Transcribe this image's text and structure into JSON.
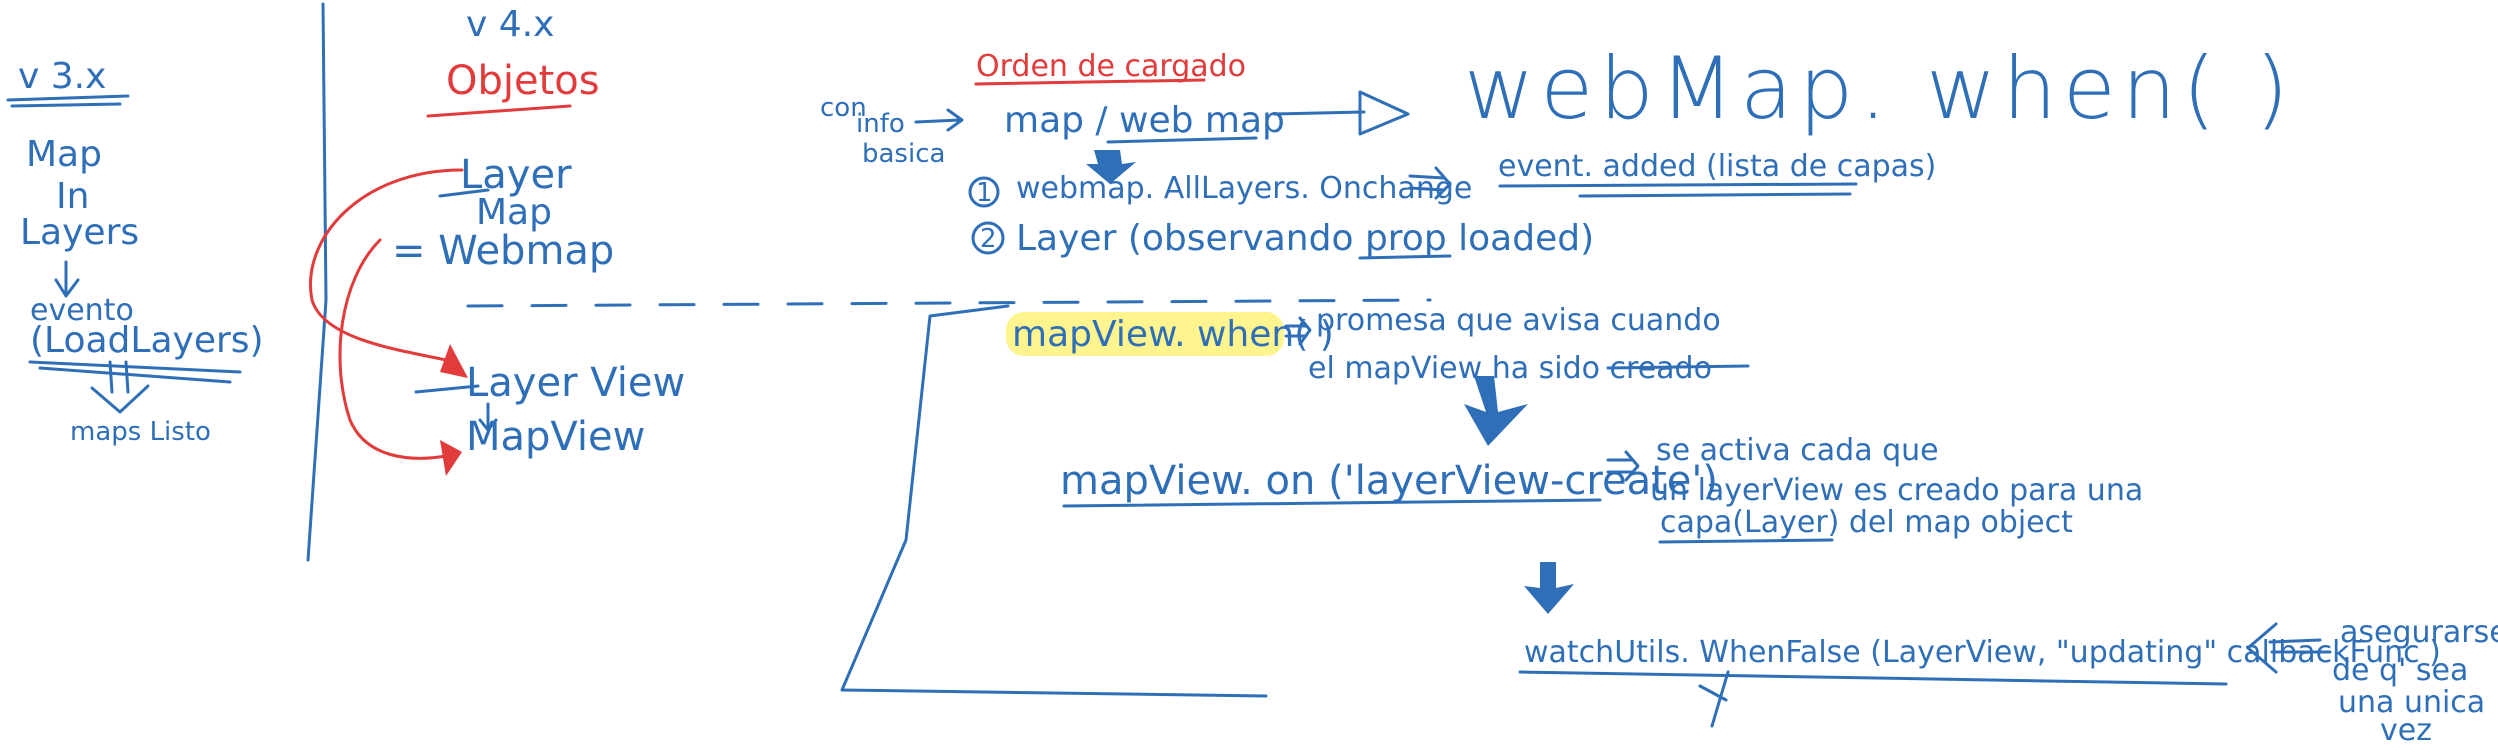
{
  "colors": {
    "ink_blue": "#2f6fb8",
    "ink_red": "#e23b3b",
    "highlighter": "#fff27a",
    "background": "#ffffff"
  },
  "left_column": {
    "version": "v 3.x",
    "map": "Map",
    "in": "In",
    "layers": "Layers",
    "evento": "evento",
    "load_layers": "(LoadLayers)",
    "maps_listo": "maps Listo"
  },
  "middle_column": {
    "version": "v 4.x",
    "objetos": "Objetos",
    "layer": "Layer",
    "map": "Map",
    "webmap": "= Webmap",
    "layer_view": "Layer View",
    "map_view": "MapView"
  },
  "loading_order": {
    "title": "Orden de cargado",
    "con_info_basica": [
      "con",
      "info",
      "basica"
    ],
    "map_webmap": "map / web map",
    "webmap_when": "webMap. when( )",
    "step1": "webmap. AllLayers. Onchange",
    "step1_result": "event. added (lista de capas)",
    "step2": "Layer (observando prop loaded)"
  },
  "mapview_flow": {
    "mapview_when": "mapView. when( )",
    "mapview_when_desc": [
      "promesa que avisa cuando",
      "el mapView ha sido creado"
    ],
    "mapview_on": "mapView. on ('layerView-create')",
    "mapview_on_desc": [
      "se activa cada que",
      "un layerView es creado para una",
      "capa(Layer) del map object"
    ],
    "watch_utils": "watchUtils. WhenFalse (LayerView, \"updating\" callbackFunc )",
    "ensure_note": [
      "asegurarse",
      "de q' sea",
      "una unica",
      "vez"
    ]
  }
}
